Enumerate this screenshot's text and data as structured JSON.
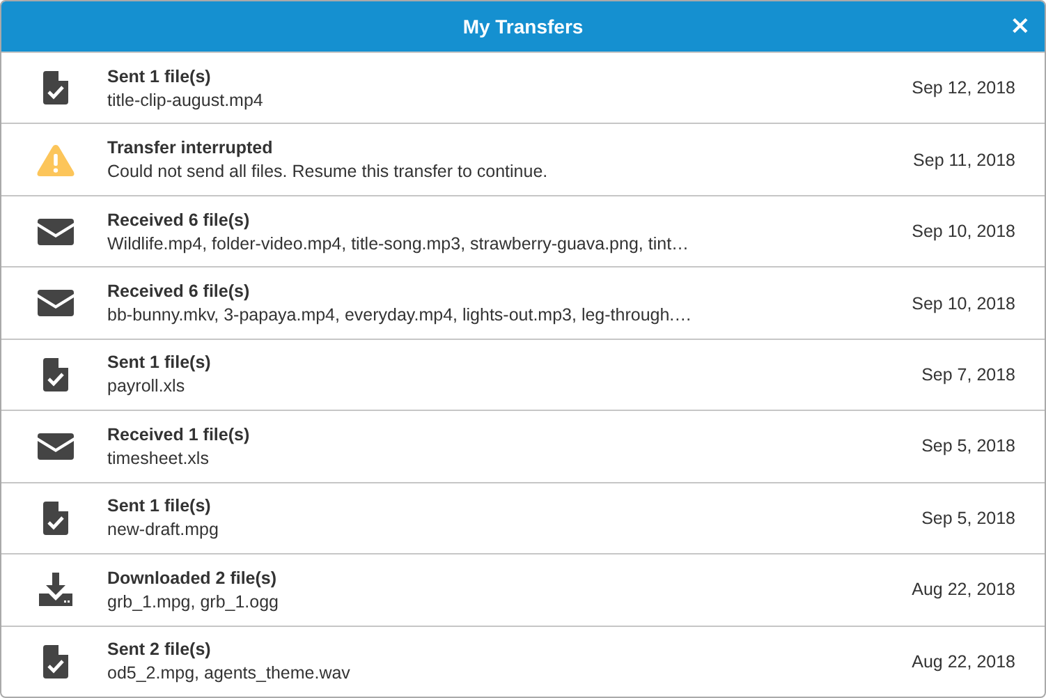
{
  "window": {
    "title": "My Transfers",
    "close": "×"
  },
  "transfers": [
    {
      "kind": "sent",
      "title": "Sent 1 file(s)",
      "detail": "title-clip-august.mp4",
      "date": "Sep 12, 2018"
    },
    {
      "kind": "warning",
      "title": "Transfer interrupted",
      "detail": "Could not send all files. Resume this transfer to continue.",
      "date": "Sep 11, 2018"
    },
    {
      "kind": "received",
      "title": "Received 6 file(s)",
      "detail": "Wildlife.mp4, folder-video.mp4, title-song.mp3, strawberry-guava.png, tint…",
      "date": "Sep 10, 2018"
    },
    {
      "kind": "received",
      "title": "Received 6 file(s)",
      "detail": "bb-bunny.mkv, 3-papaya.mp4, everyday.mp4, lights-out.mp3, leg-through.…",
      "date": "Sep 10, 2018"
    },
    {
      "kind": "sent",
      "title": "Sent 1 file(s)",
      "detail": "payroll.xls",
      "date": "Sep 7, 2018"
    },
    {
      "kind": "received",
      "title": "Received 1 file(s)",
      "detail": "timesheet.xls",
      "date": "Sep 5, 2018"
    },
    {
      "kind": "sent",
      "title": "Sent 1 file(s)",
      "detail": "new-draft.mpg",
      "date": "Sep 5, 2018"
    },
    {
      "kind": "downloaded",
      "title": "Downloaded 2 file(s)",
      "detail": "grb_1.mpg, grb_1.ogg",
      "date": "Aug 22, 2018"
    },
    {
      "kind": "sent",
      "title": "Sent 2 file(s)",
      "detail": "od5_2.mpg, agents_theme.wav",
      "date": "Aug 22, 2018"
    }
  ]
}
